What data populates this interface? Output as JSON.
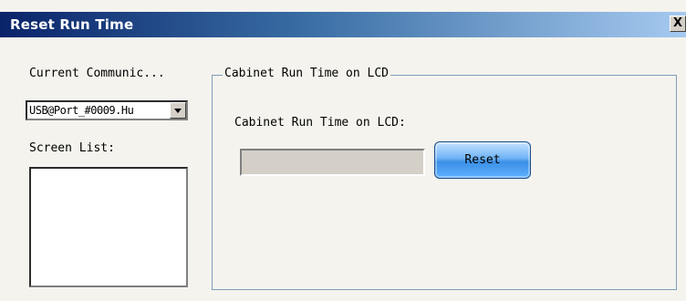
{
  "window": {
    "title": "Reset Run Time",
    "close_label": "X"
  },
  "left_panel": {
    "communication_label": "Current Communic...",
    "communication_value": "USB@Port_#0009.Hu",
    "screen_list_label": "Screen List:"
  },
  "group": {
    "legend": "Cabinet Run Time on LCD",
    "field_label": "Cabinet Run Time on LCD:",
    "field_value": "",
    "reset_label": "Reset"
  },
  "colors": {
    "title_start": "#0a246a",
    "title_end": "#a6caf0",
    "group_border": "#7f9db9",
    "button_blue": "#3b8fe6"
  }
}
